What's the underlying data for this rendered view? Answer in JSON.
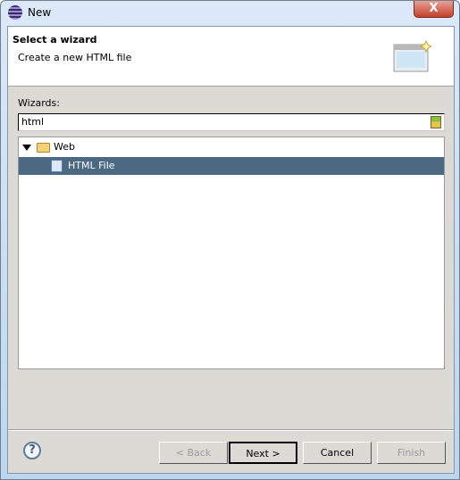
{
  "window": {
    "title": "New",
    "close_label": "X"
  },
  "header": {
    "title": "Select a wizard",
    "description": "Create a new HTML file"
  },
  "filter": {
    "label": "Wizards:",
    "value": "html"
  },
  "tree": {
    "items": [
      {
        "label": "Web",
        "icon": "folder-open-icon",
        "expanded": true
      },
      {
        "label": "HTML File",
        "icon": "html-file-icon",
        "selected": true
      }
    ]
  },
  "buttons": {
    "back": "< Back",
    "next": "Next >",
    "cancel": "Cancel",
    "finish": "Finish",
    "help": "?"
  },
  "colors": {
    "selection": "#4b6983",
    "dialog_bg": "#dcdad5"
  }
}
